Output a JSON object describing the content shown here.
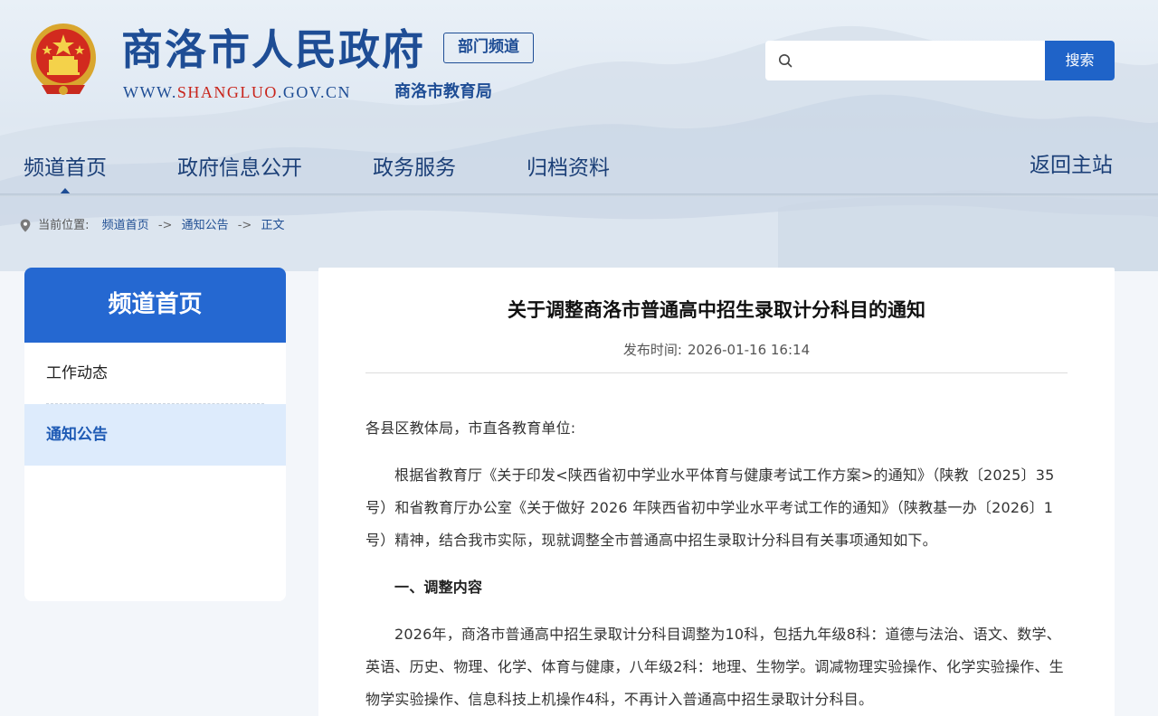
{
  "header": {
    "site_title": "商洛市人民政府",
    "channel_badge": "部门频道",
    "url_prefix": "WWW.",
    "url_domain": "SHANGLUO",
    "url_suffix": ".GOV.CN",
    "department": "商洛市教育局",
    "search": {
      "placeholder": "",
      "button_label": "搜索"
    }
  },
  "nav": {
    "items": [
      "频道首页",
      "政府信息公开",
      "政务服务",
      "归档资料"
    ],
    "back_label": "返回主站"
  },
  "breadcrumb": {
    "prefix": "当前位置:",
    "items": [
      "频道首页",
      "通知公告",
      "正文"
    ],
    "separator": "->"
  },
  "sidebar": {
    "title": "频道首页",
    "items": [
      {
        "label": "工作动态",
        "active": false
      },
      {
        "label": "通知公告",
        "active": true
      }
    ]
  },
  "article": {
    "title": "关于调整商洛市普通高中招生录取计分科目的通知",
    "published_label": "发布时间:",
    "published_time": "2026-01-16 16:14",
    "salutation": "各县区教体局，市直各教育单位:",
    "paragraph1": "根据省教育厅《关于印发<陕西省初中学业水平体育与健康考试工作方案>的通知》（陕教〔2025〕35号）和省教育厅办公室《关于做好 2026 年陕西省初中学业水平考试工作的通知》（陕教基一办〔2026〕1号）精神，结合我市实际，现就调整全市普通高中招生录取计分科目有关事项通知如下。",
    "section1_heading": "一、调整内容",
    "paragraph2": "2026年，商洛市普通高中招生录取计分科目调整为10科，包括九年级8科：道德与法治、语文、数学、英语、历史、物理、化学、体育与健康，八年级2科：地理、生物学。调减物理实验操作、化学实验操作、生物学实验操作、信息科技上机操作4科，不再计入普通高中招生录取计分科目。"
  },
  "colors": {
    "brand_blue": "#1e4d95",
    "accent_blue": "#2568d1",
    "url_red": "#c8241b",
    "active_bg": "#ddebfc"
  }
}
